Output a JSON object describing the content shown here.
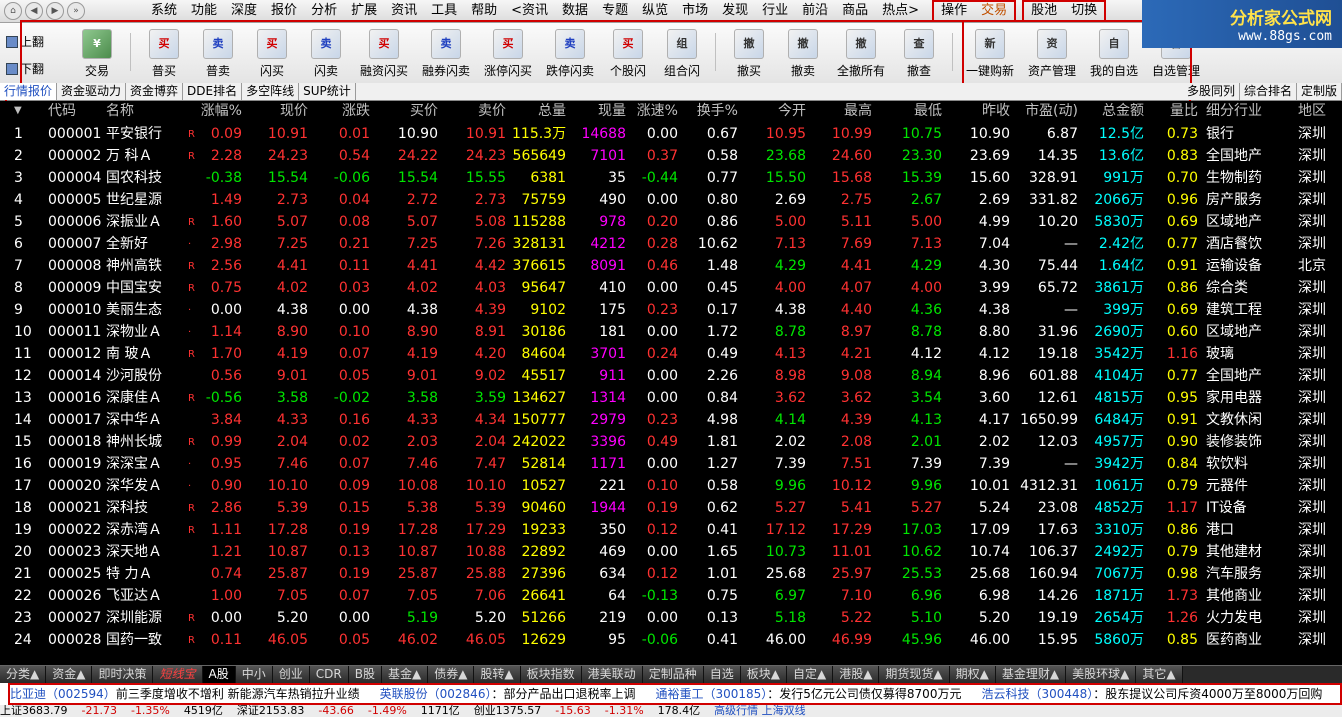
{
  "menubar": {
    "items": [
      "系统",
      "功能",
      "深度",
      "报价",
      "分析",
      "扩展",
      "资讯",
      "工具",
      "帮助",
      "<资讯",
      "数据",
      "专题",
      "纵览",
      "市场",
      "发现",
      "行业",
      "前沿",
      "商品",
      "热点>"
    ],
    "boxed1": [
      "操作",
      "交易"
    ],
    "boxed2": [
      "股池",
      "切换"
    ]
  },
  "logo": {
    "title": "分析家公式网",
    "url": "www.88gs.com"
  },
  "pageflip": {
    "up": "上翻",
    "down": "下翻"
  },
  "toolbar": {
    "tools": [
      {
        "label": "交易",
        "icon": "trade"
      },
      {
        "label": "普买",
        "icon": "买"
      },
      {
        "label": "普卖",
        "icon": "卖"
      },
      {
        "label": "闪买",
        "icon": "买"
      },
      {
        "label": "闪卖",
        "icon": "卖"
      },
      {
        "label": "融资闪买",
        "icon": "买"
      },
      {
        "label": "融券闪卖",
        "icon": "卖"
      },
      {
        "label": "涨停闪买",
        "icon": "买"
      },
      {
        "label": "跌停闪卖",
        "icon": "卖"
      },
      {
        "label": "个股闪",
        "icon": "买"
      },
      {
        "label": "组合闪",
        "icon": "组"
      },
      {
        "label": "撤买",
        "icon": "撤"
      },
      {
        "label": "撤卖",
        "icon": "撤"
      },
      {
        "label": "全撤所有",
        "icon": "撤"
      },
      {
        "label": "撤查",
        "icon": "查"
      },
      {
        "label": "一键购新",
        "icon": "新"
      },
      {
        "label": "资产管理",
        "icon": "资"
      },
      {
        "label": "我的自选",
        "icon": "自"
      },
      {
        "label": "自选管理",
        "icon": "管"
      }
    ]
  },
  "subtabs": {
    "left": [
      "行情报价",
      "资金驱动力",
      "资金博弈",
      "DDE排名",
      "多空阵线",
      "SUP统计"
    ],
    "right": [
      "多股同列",
      "综合排名",
      "定制版"
    ]
  },
  "table": {
    "headers": [
      "代码",
      "名称",
      "涨幅%",
      "现价",
      "涨跌",
      "买价",
      "卖价",
      "总量",
      "现量",
      "涨速%",
      "换手%",
      "今开",
      "最高",
      "最低",
      "昨收",
      "市盈(动)",
      "总金额",
      "量比",
      "细分行业",
      "地区"
    ],
    "rows": [
      [
        "1",
        "000001",
        "平安银行",
        "R",
        "0.09",
        "10.91",
        "0.01",
        "10.90",
        "10.91",
        "115.3万",
        "14688",
        "0.00",
        "0.67",
        "10.95",
        "10.99",
        "10.75",
        "10.90",
        "6.87",
        "12.5亿",
        "0.73",
        "银行",
        "深圳"
      ],
      [
        "2",
        "000002",
        "万 科Ａ",
        "R",
        "2.28",
        "24.23",
        "0.54",
        "24.22",
        "24.23",
        "565649",
        "7101",
        "0.37",
        "0.58",
        "23.68",
        "24.60",
        "23.30",
        "23.69",
        "14.35",
        "13.6亿",
        "0.83",
        "全国地产",
        "深圳"
      ],
      [
        "3",
        "000004",
        "国农科技",
        "",
        "-0.38",
        "15.54",
        "-0.06",
        "15.54",
        "15.55",
        "6381",
        "35",
        "-0.44",
        "0.77",
        "15.50",
        "15.68",
        "15.39",
        "15.60",
        "328.91",
        "991万",
        "0.70",
        "生物制药",
        "深圳"
      ],
      [
        "4",
        "000005",
        "世纪星源",
        "",
        "1.49",
        "2.73",
        "0.04",
        "2.72",
        "2.73",
        "75759",
        "490",
        "0.00",
        "0.80",
        "2.69",
        "2.75",
        "2.67",
        "2.69",
        "331.82",
        "2066万",
        "0.96",
        "房产服务",
        "深圳"
      ],
      [
        "5",
        "000006",
        "深振业Ａ",
        "R",
        "1.60",
        "5.07",
        "0.08",
        "5.07",
        "5.08",
        "115288",
        "978",
        "0.20",
        "0.86",
        "5.00",
        "5.11",
        "5.00",
        "4.99",
        "10.20",
        "5830万",
        "0.69",
        "区域地产",
        "深圳"
      ],
      [
        "6",
        "000007",
        "全新好",
        "·",
        "2.98",
        "7.25",
        "0.21",
        "7.25",
        "7.26",
        "328131",
        "4212",
        "0.28",
        "10.62",
        "7.13",
        "7.69",
        "7.13",
        "7.04",
        "—",
        "2.42亿",
        "0.77",
        "酒店餐饮",
        "深圳"
      ],
      [
        "7",
        "000008",
        "神州高铁",
        "R",
        "2.56",
        "4.41",
        "0.11",
        "4.41",
        "4.42",
        "376615",
        "8091",
        "0.46",
        "1.48",
        "4.29",
        "4.41",
        "4.29",
        "4.30",
        "75.44",
        "1.64亿",
        "0.91",
        "运输设备",
        "北京"
      ],
      [
        "8",
        "000009",
        "中国宝安",
        "R",
        "0.75",
        "4.02",
        "0.03",
        "4.02",
        "4.03",
        "95647",
        "410",
        "0.00",
        "0.45",
        "4.00",
        "4.07",
        "4.00",
        "3.99",
        "65.72",
        "3861万",
        "0.86",
        "综合类",
        "深圳"
      ],
      [
        "9",
        "000010",
        "美丽生态",
        "·",
        "0.00",
        "4.38",
        "0.00",
        "4.38",
        "4.39",
        "9102",
        "175",
        "0.23",
        "0.17",
        "4.38",
        "4.40",
        "4.36",
        "4.38",
        "—",
        "399万",
        "0.69",
        "建筑工程",
        "深圳"
      ],
      [
        "10",
        "000011",
        "深物业Ａ",
        "·",
        "1.14",
        "8.90",
        "0.10",
        "8.90",
        "8.91",
        "30186",
        "181",
        "0.00",
        "1.72",
        "8.78",
        "8.97",
        "8.78",
        "8.80",
        "31.96",
        "2690万",
        "0.60",
        "区域地产",
        "深圳"
      ],
      [
        "11",
        "000012",
        "南 玻Ａ",
        "R",
        "1.70",
        "4.19",
        "0.07",
        "4.19",
        "4.20",
        "84604",
        "3701",
        "0.24",
        "0.49",
        "4.13",
        "4.21",
        "4.12",
        "4.12",
        "19.18",
        "3542万",
        "1.16",
        "玻璃",
        "深圳"
      ],
      [
        "12",
        "000014",
        "沙河股份",
        "",
        "0.56",
        "9.01",
        "0.05",
        "9.01",
        "9.02",
        "45517",
        "911",
        "0.00",
        "2.26",
        "8.98",
        "9.08",
        "8.94",
        "8.96",
        "601.88",
        "4104万",
        "0.77",
        "全国地产",
        "深圳"
      ],
      [
        "13",
        "000016",
        "深康佳Ａ",
        "R",
        "-0.56",
        "3.58",
        "-0.02",
        "3.58",
        "3.59",
        "134627",
        "1314",
        "0.00",
        "0.84",
        "3.62",
        "3.62",
        "3.54",
        "3.60",
        "12.61",
        "4815万",
        "0.95",
        "家用电器",
        "深圳"
      ],
      [
        "14",
        "000017",
        "深中华Ａ",
        "",
        "3.84",
        "4.33",
        "0.16",
        "4.33",
        "4.34",
        "150777",
        "2979",
        "0.23",
        "4.98",
        "4.14",
        "4.39",
        "4.13",
        "4.17",
        "1650.99",
        "6484万",
        "0.91",
        "文教休闲",
        "深圳"
      ],
      [
        "15",
        "000018",
        "神州长城",
        "R",
        "0.99",
        "2.04",
        "0.02",
        "2.03",
        "2.04",
        "242022",
        "3396",
        "0.49",
        "1.81",
        "2.02",
        "2.08",
        "2.01",
        "2.02",
        "12.03",
        "4957万",
        "0.90",
        "装修装饰",
        "深圳"
      ],
      [
        "16",
        "000019",
        "深深宝Ａ",
        "·",
        "0.95",
        "7.46",
        "0.07",
        "7.46",
        "7.47",
        "52814",
        "1171",
        "0.00",
        "1.27",
        "7.39",
        "7.51",
        "7.39",
        "7.39",
        "—",
        "3942万",
        "0.84",
        "软饮料",
        "深圳"
      ],
      [
        "17",
        "000020",
        "深华发Ａ",
        "·",
        "0.90",
        "10.10",
        "0.09",
        "10.08",
        "10.10",
        "10527",
        "221",
        "0.10",
        "0.58",
        "9.96",
        "10.12",
        "9.96",
        "10.01",
        "4312.31",
        "1061万",
        "0.79",
        "元器件",
        "深圳"
      ],
      [
        "18",
        "000021",
        "深科技",
        "R",
        "2.86",
        "5.39",
        "0.15",
        "5.38",
        "5.39",
        "90460",
        "1944",
        "0.19",
        "0.62",
        "5.27",
        "5.41",
        "5.27",
        "5.24",
        "23.08",
        "4852万",
        "1.17",
        "IT设备",
        "深圳"
      ],
      [
        "19",
        "000022",
        "深赤湾Ａ",
        "R",
        "1.11",
        "17.28",
        "0.19",
        "17.28",
        "17.29",
        "19233",
        "350",
        "0.12",
        "0.41",
        "17.12",
        "17.29",
        "17.03",
        "17.09",
        "17.63",
        "3310万",
        "0.86",
        "港口",
        "深圳"
      ],
      [
        "20",
        "000023",
        "深天地Ａ",
        "",
        "1.21",
        "10.87",
        "0.13",
        "10.87",
        "10.88",
        "22892",
        "469",
        "0.00",
        "1.65",
        "10.73",
        "11.01",
        "10.62",
        "10.74",
        "106.37",
        "2492万",
        "0.79",
        "其他建材",
        "深圳"
      ],
      [
        "21",
        "000025",
        "特 力Ａ",
        "",
        "0.74",
        "25.87",
        "0.19",
        "25.87",
        "25.88",
        "27396",
        "634",
        "0.12",
        "1.01",
        "25.68",
        "25.97",
        "25.53",
        "25.68",
        "160.94",
        "7067万",
        "0.98",
        "汽车服务",
        "深圳"
      ],
      [
        "22",
        "000026",
        "飞亚达Ａ",
        "",
        "1.00",
        "7.05",
        "0.07",
        "7.05",
        "7.06",
        "26641",
        "64",
        "-0.13",
        "0.75",
        "6.97",
        "7.10",
        "6.96",
        "6.98",
        "14.26",
        "1871万",
        "1.73",
        "其他商业",
        "深圳"
      ],
      [
        "23",
        "000027",
        "深圳能源",
        "R",
        "0.00",
        "5.20",
        "0.00",
        "5.19",
        "5.20",
        "51266",
        "219",
        "0.00",
        "0.13",
        "5.18",
        "5.22",
        "5.10",
        "5.20",
        "19.19",
        "2654万",
        "1.26",
        "火力发电",
        "深圳"
      ],
      [
        "24",
        "000028",
        "国药一致",
        "R",
        "0.11",
        "46.05",
        "0.05",
        "46.02",
        "46.05",
        "12629",
        "95",
        "-0.06",
        "0.41",
        "46.00",
        "46.99",
        "45.96",
        "46.00",
        "15.95",
        "5860万",
        "0.85",
        "医药商业",
        "深圳"
      ]
    ]
  },
  "tabbar": [
    "分类▲",
    "资金▲",
    "即时决策",
    "短线宝",
    "A股",
    "中小",
    "创业",
    "CDR",
    "B股",
    "基金▲",
    "债券▲",
    "股转▲",
    "板块指数",
    "港美联动",
    "定制品种",
    "自选",
    "板块▲",
    "自定▲",
    "港股▲",
    "期货现货▲",
    "期权▲",
    "基金理财▲",
    "美股环球▲",
    "其它▲"
  ],
  "news": [
    {
      "stock": "比亚迪（002594）",
      "text": "前三季度增收不增利 新能源汽车热销拉升业绩"
    },
    {
      "stock": "英联股份（002846）",
      "text": "：部分产品出口退税率上调"
    },
    {
      "stock": "通裕重工（300185）",
      "text": "：发行5亿元公司债仅募得8700万元"
    },
    {
      "stock": "浩云科技（300448）",
      "text": "：股东提议公司斥资4000万至8000万回购"
    }
  ],
  "statusbar": [
    "上证3683.79",
    "-21.73",
    "-1.35%",
    "4519亿",
    "深证2153.83",
    "-43.66",
    "-1.49%",
    "1171亿",
    "创业1375.57",
    "-15.63",
    "-1.31%",
    "178.4亿",
    "高级行情 上海双线"
  ]
}
